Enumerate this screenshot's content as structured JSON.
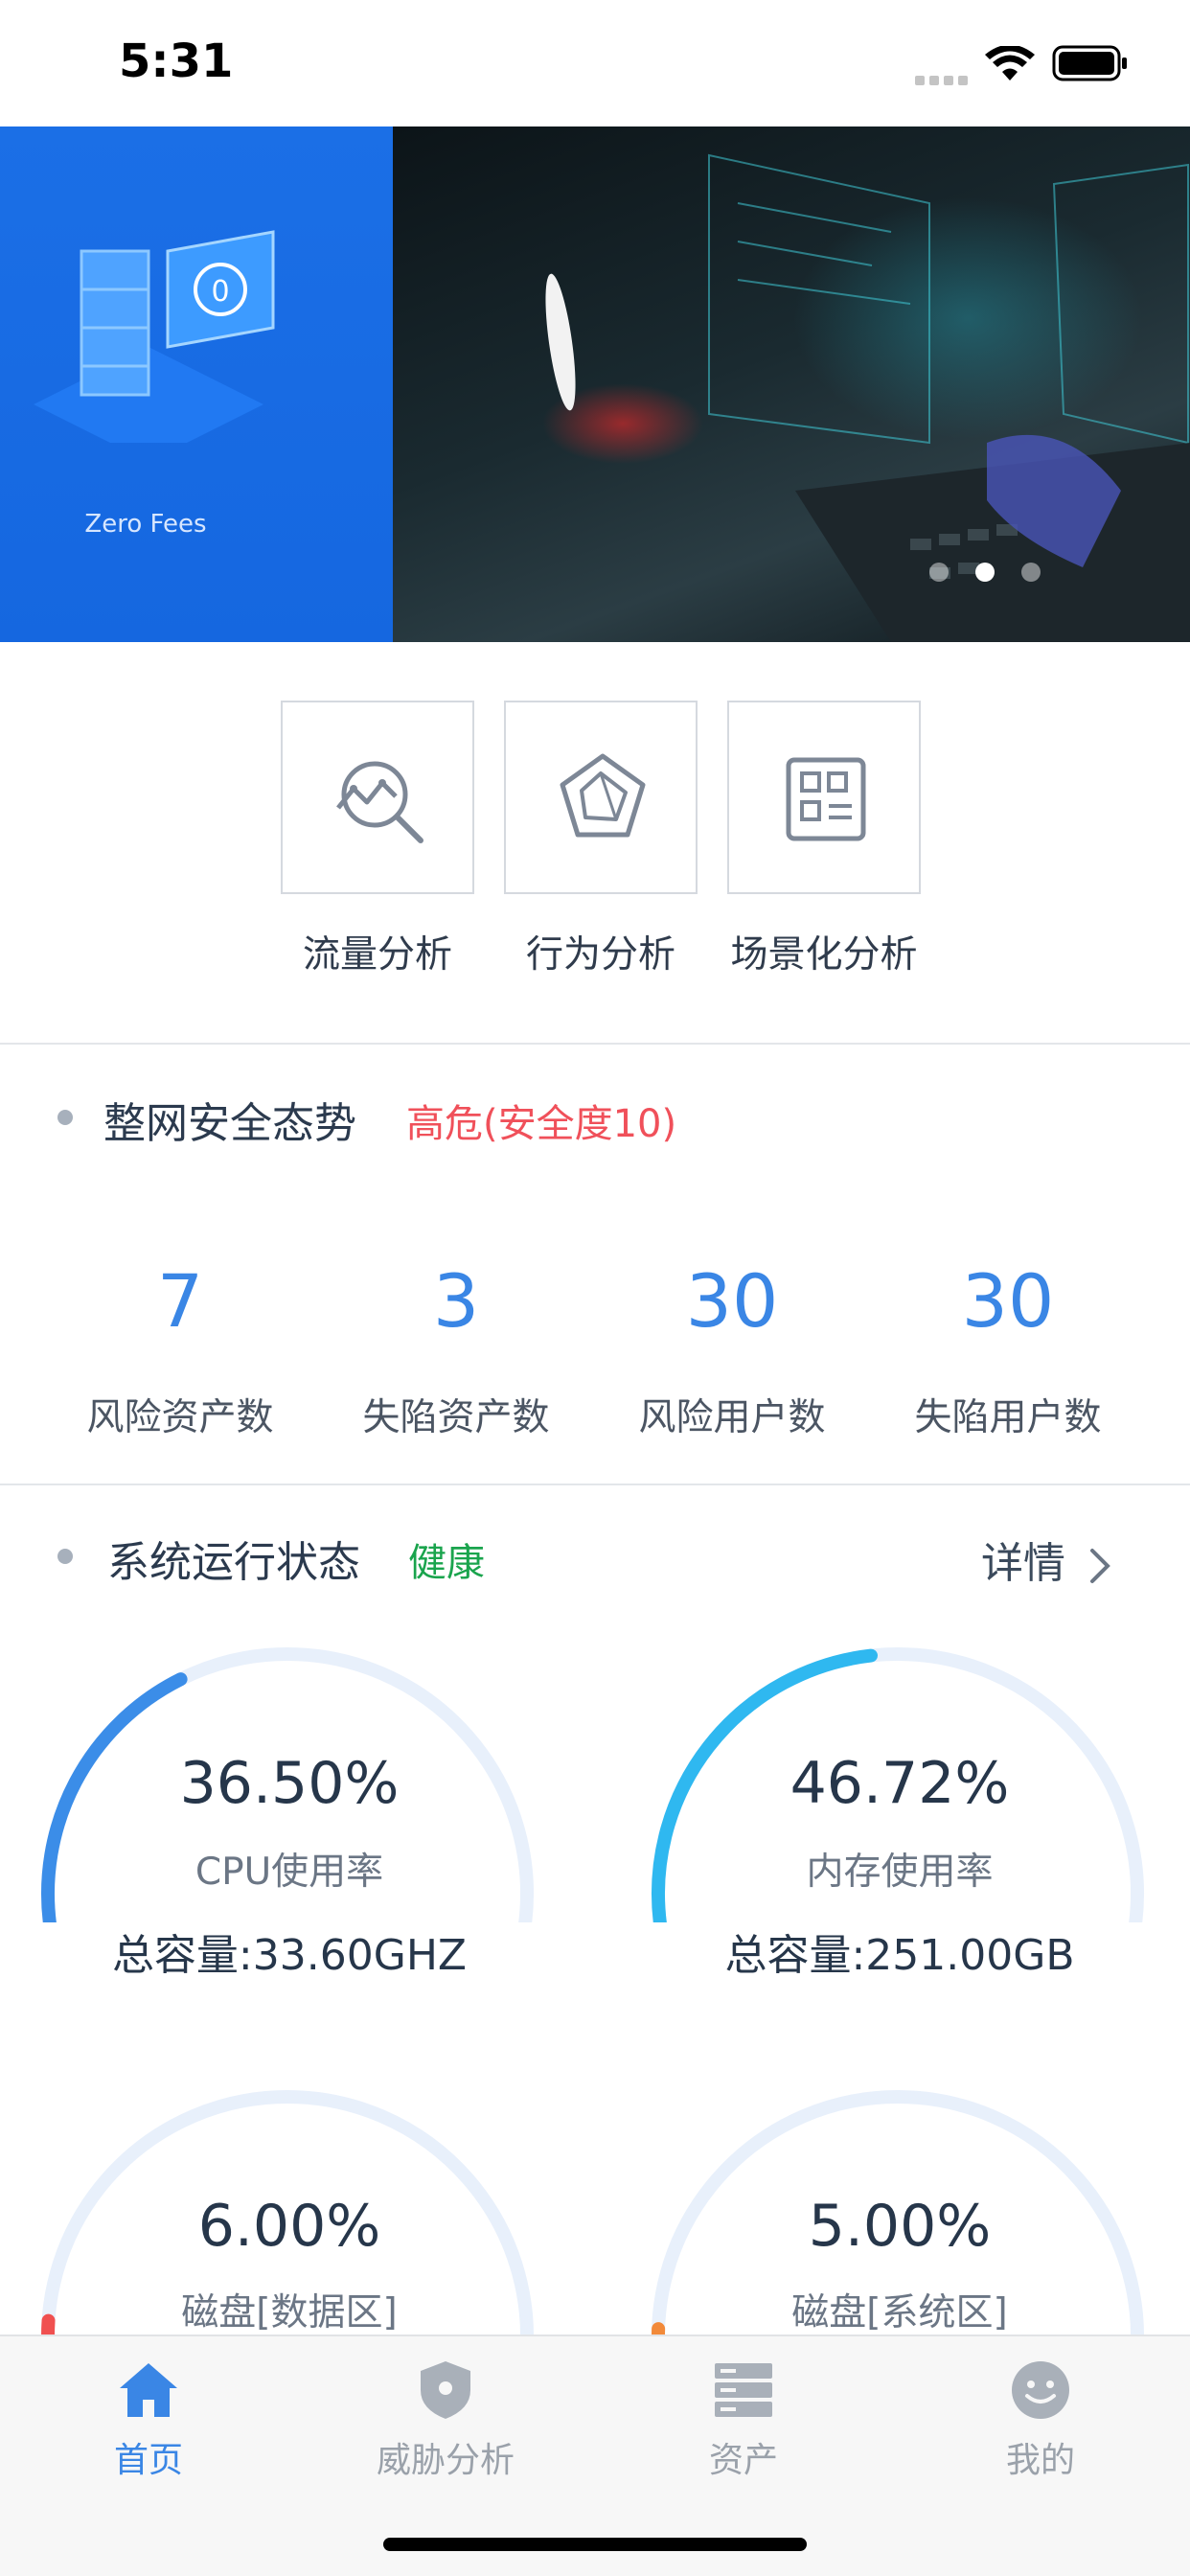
{
  "status_bar": {
    "time": "5:31"
  },
  "banner": {
    "left_caption": "Zero Fees",
    "left_icon_text": "0",
    "pagination": {
      "count": 3,
      "active_index": 1
    }
  },
  "quick_entries": [
    {
      "label": "流量分析",
      "icon": "traffic-analysis-icon"
    },
    {
      "label": "行为分析",
      "icon": "behavior-analysis-icon"
    },
    {
      "label": "场景化分析",
      "icon": "scenario-analysis-icon"
    }
  ],
  "security_posture": {
    "title": "整网安全态势",
    "status": "高危(安全度10)",
    "status_color": "#f0505a",
    "stats": [
      {
        "value": "7",
        "label": "风险资产数"
      },
      {
        "value": "3",
        "label": "失陷资产数"
      },
      {
        "value": "30",
        "label": "风险用户数"
      },
      {
        "value": "30",
        "label": "失陷用户数"
      }
    ]
  },
  "system_status": {
    "title": "系统运行状态",
    "status": "健康",
    "status_color": "#1aa44d",
    "details_label": "详情",
    "gauges": [
      {
        "value": "36.50%",
        "fraction": 0.365,
        "label": "CPU使用率",
        "total": "总容量:33.60GHZ",
        "color": "#3b8de8"
      },
      {
        "value": "46.72%",
        "fraction": 0.4672,
        "label": "内存使用率",
        "total": "总容量:251.00GB",
        "color": "#2fb8f0"
      },
      {
        "value": "6.00%",
        "fraction": 0.06,
        "label": "磁盘[数据区]",
        "color": "#f05050"
      },
      {
        "value": "5.00%",
        "fraction": 0.05,
        "label": "磁盘[系统区]",
        "color": "#f28a3a"
      }
    ]
  },
  "tab_bar": {
    "tabs": [
      {
        "label": "首页",
        "icon": "home-icon",
        "active": true
      },
      {
        "label": "威胁分析",
        "icon": "shield-icon",
        "active": false
      },
      {
        "label": "资产",
        "icon": "server-icon",
        "active": false
      },
      {
        "label": "我的",
        "icon": "smiley-icon",
        "active": false
      }
    ]
  },
  "colors": {
    "accent": "#3a86e5",
    "gauge_track": "#e8f0fb"
  }
}
